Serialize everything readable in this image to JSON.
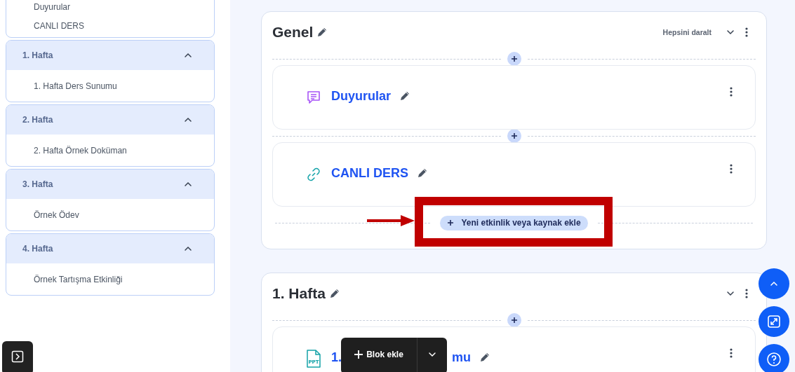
{
  "sidebar": {
    "sections": [
      {
        "items": [
          "Duyurular",
          "CANLI DERS"
        ]
      },
      {
        "title": "1. Hafta",
        "expanded": true,
        "items": [
          "1. Hafta Ders Sunumu"
        ]
      },
      {
        "title": "2. Hafta",
        "expanded": true,
        "items": [
          "2. Hafta Örnek Doküman"
        ]
      },
      {
        "title": "3. Hafta",
        "expanded": true,
        "items": [
          "Örnek Ödev"
        ]
      },
      {
        "title": "4. Hafta",
        "expanded": true,
        "items": [
          "Örnek Tartışma Etkinliği"
        ]
      }
    ]
  },
  "course": {
    "sections": [
      {
        "title": "Genel",
        "collapse_all": "Hepsini daralt",
        "expanded": true,
        "activities": [
          {
            "kind": "forum",
            "title_parts": [
              "Duyurular"
            ]
          },
          {
            "kind": "url",
            "title_parts": [
              "CANLI DERS"
            ]
          }
        ],
        "add_button": "Yeni etkinlik veya kaynak ekle"
      },
      {
        "title": "1. Hafta",
        "expanded": true,
        "activities": [
          {
            "kind": "ppt",
            "icon_label": "PPT",
            "title_parts": [
              "1.",
              "mu"
            ]
          }
        ]
      }
    ]
  },
  "callout": {
    "arrow": true,
    "frame": true
  },
  "block_toolbar": {
    "label": "Blok ekle"
  },
  "floating_buttons": [
    {
      "kind": "scroll-top"
    },
    {
      "kind": "fullscreen"
    },
    {
      "kind": "help"
    }
  ]
}
